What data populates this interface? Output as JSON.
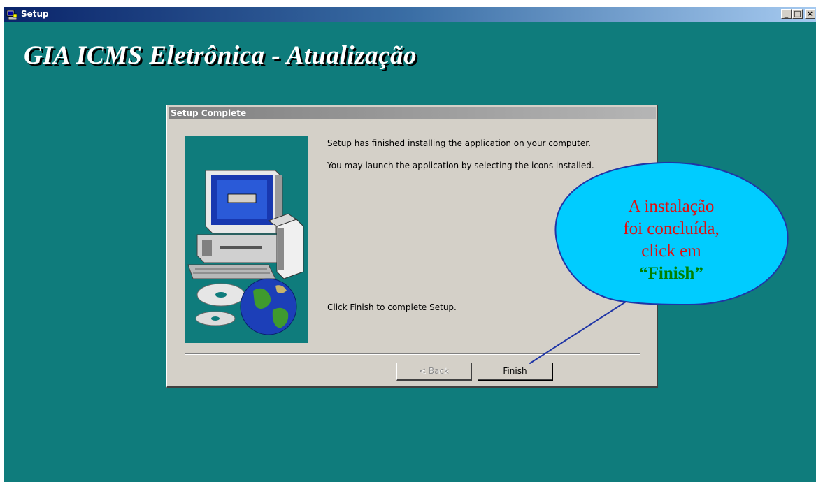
{
  "window": {
    "title": "Setup",
    "controls": {
      "minimize": "_",
      "maximize": "□",
      "close": "×"
    }
  },
  "banner": {
    "text": "GIA ICMS Eletrônica - Atualização"
  },
  "dialog": {
    "title": "Setup Complete",
    "line1": "Setup has finished installing the application on your computer.",
    "line2": "You may launch the application by selecting the icons installed.",
    "line3": "Click Finish to complete Setup.",
    "back_label": "< Back",
    "finish_label": "Finish"
  },
  "callout": {
    "line1": "A instalação",
    "line2": "foi concluída,",
    "line3": "click em",
    "quote_open": "“",
    "finish_word": "Finish",
    "quote_close": "”"
  },
  "colors": {
    "desktop": "#0f7c7c",
    "bubble_fill": "#00ccff",
    "bubble_stroke": "#1f35a6",
    "callout_text": "#e01010",
    "callout_finish": "#008000"
  },
  "icons": [
    "setup-app-icon",
    "computer-icon",
    "cd-icon",
    "globe-icon"
  ]
}
